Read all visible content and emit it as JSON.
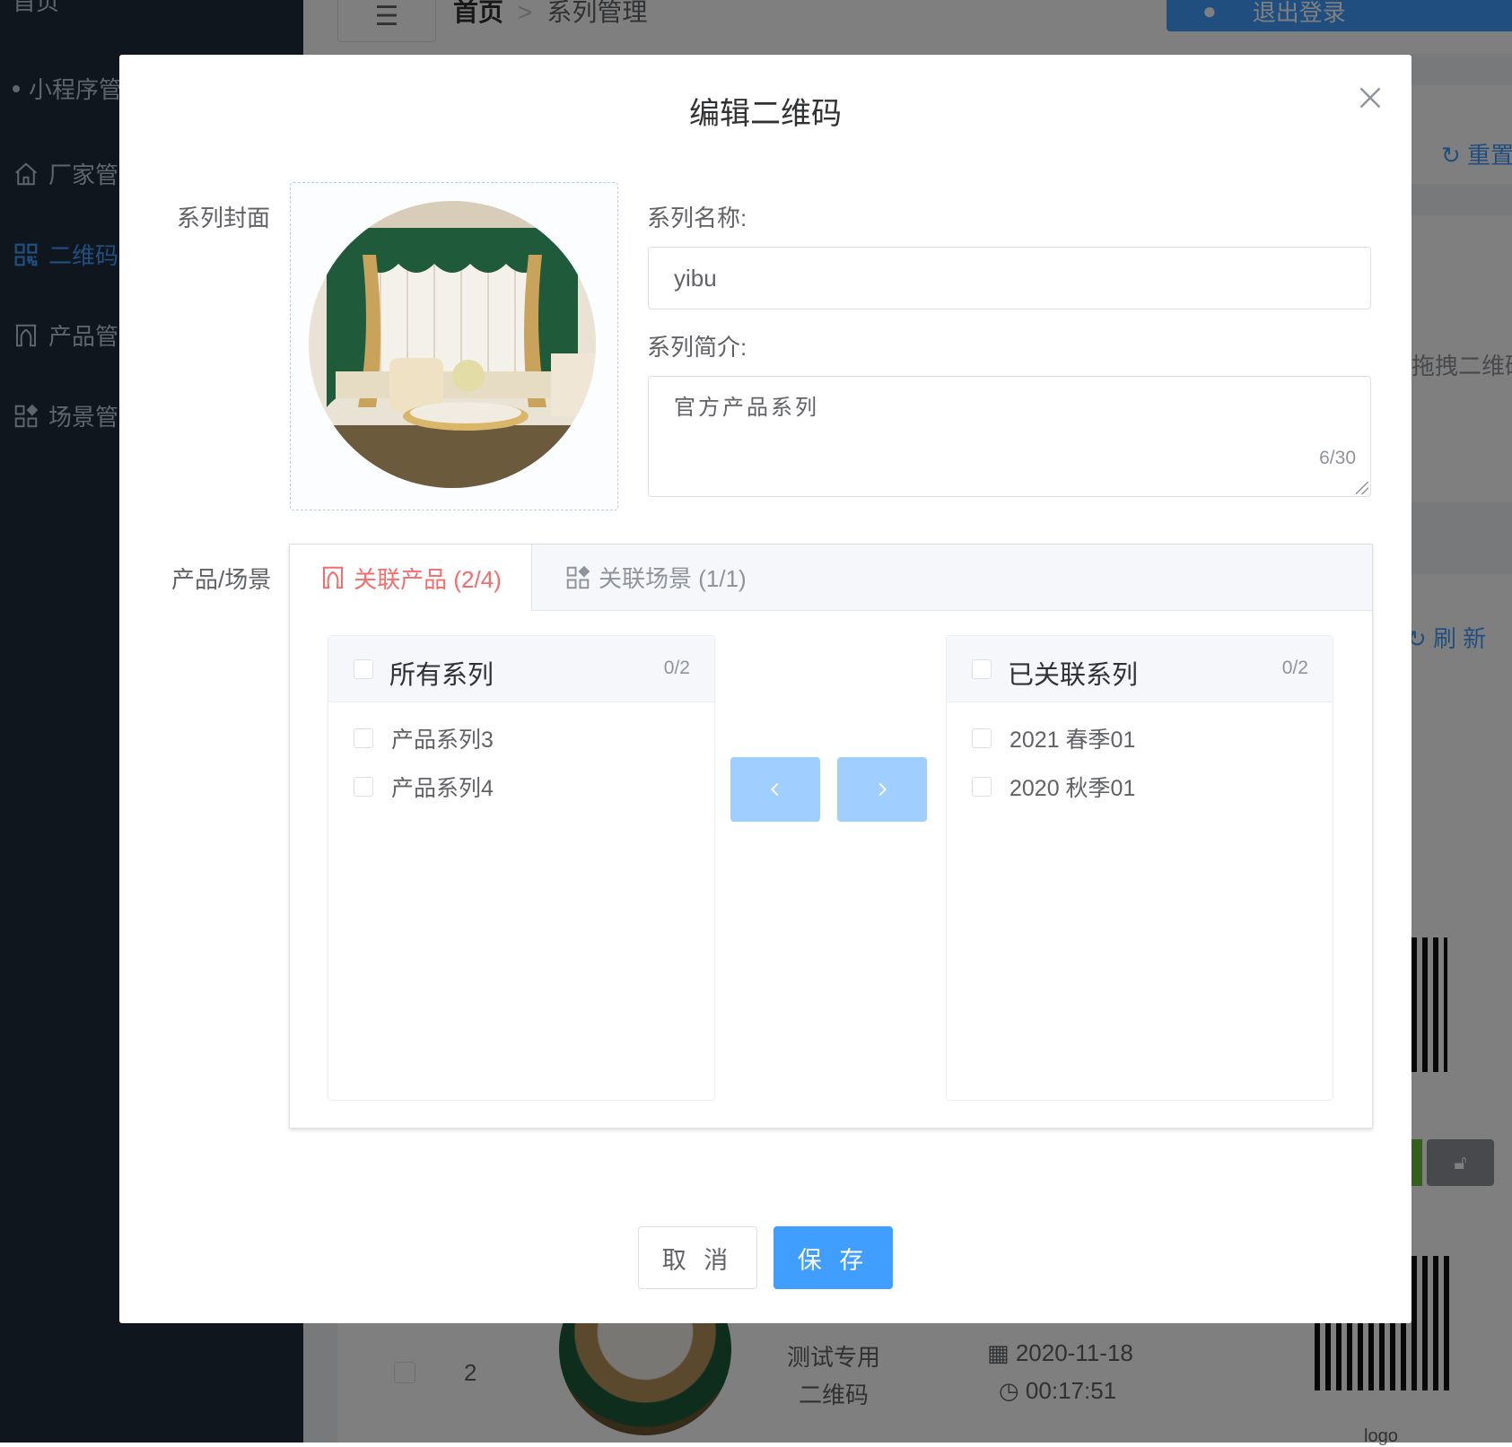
{
  "background": {
    "sidebar": {
      "items": [
        {
          "label": "首页",
          "icon": "home-icon"
        },
        {
          "label": "小程序管理",
          "icon": "dot-icon"
        },
        {
          "label": "厂家管理",
          "icon": "house-icon"
        },
        {
          "label": "二维码管",
          "icon": "qrcode-icon",
          "active": true
        },
        {
          "label": "产品管理",
          "icon": "curtain-icon"
        },
        {
          "label": "场景管理",
          "icon": "scene-icon"
        }
      ]
    },
    "breadcrumb": {
      "home": "首页",
      "separator": ">",
      "current": "系列管理"
    },
    "header_buttons": {
      "user": "●",
      "logout": "退出登录"
    },
    "toolbar": {
      "reset": "重置",
      "refresh": "刷 新"
    },
    "search_hint": "拖拽二维码",
    "table_row": {
      "index": "2",
      "name_line1": "测试专用",
      "name_line2": "二维码",
      "date": "2020-11-18",
      "time": "00:17:51",
      "logo_label": "logo"
    }
  },
  "dialog": {
    "title": "编辑二维码",
    "labels": {
      "cover": "系列封面",
      "name": "系列名称:",
      "intro": "系列简介:",
      "products_scenes": "产品/场景"
    },
    "name_value": "yibu",
    "intro_value": "官方产品系列",
    "intro_counter": "6/30",
    "tabs": [
      {
        "label": "关联产品 (2/4)",
        "icon": "curtain-icon",
        "active": true
      },
      {
        "label": "关联场景 (1/1)",
        "icon": "scene-icon",
        "active": false
      }
    ],
    "transfer": {
      "left": {
        "title": "所有系列",
        "count": "0/2",
        "items": [
          "产品系列3",
          "产品系列4"
        ]
      },
      "right": {
        "title": "已关联系列",
        "count": "0/2",
        "items": [
          "2021 春季01",
          "2020 秋季01"
        ]
      }
    },
    "buttons": {
      "cancel": "取 消",
      "save": "保 存"
    }
  },
  "colors": {
    "primary": "#409eff",
    "primary_disabled": "#a0cfff",
    "active_tab": "#f56c6c",
    "sidebar_bg": "#1f2d3d"
  }
}
